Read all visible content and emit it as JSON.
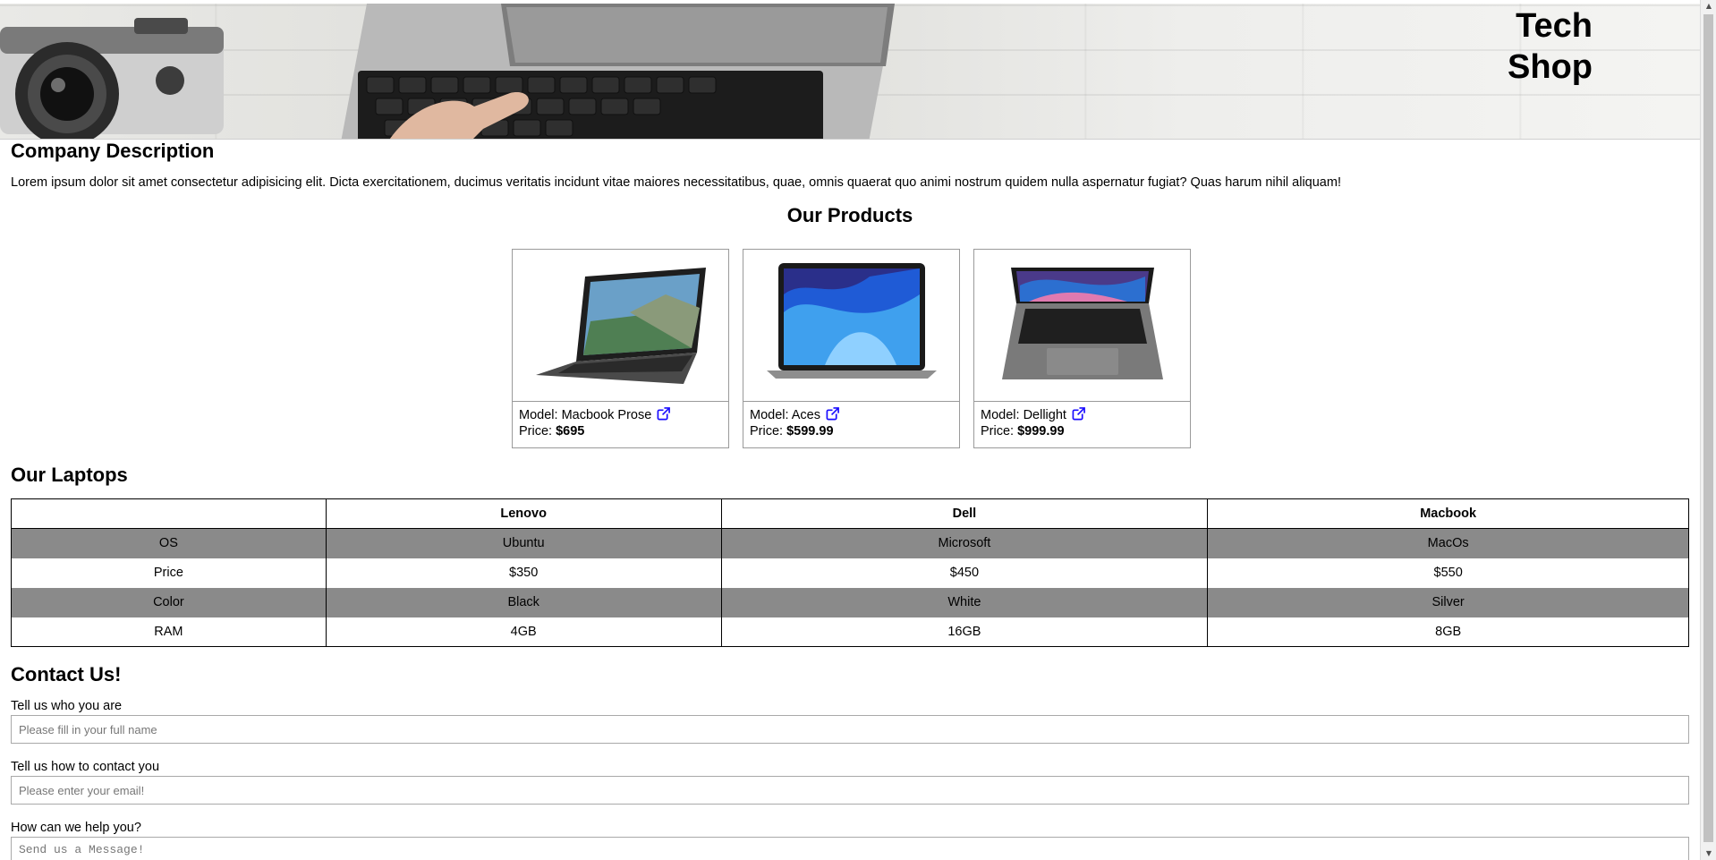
{
  "header": {
    "brand_line1": "Tech",
    "brand_line2": "Shop"
  },
  "company": {
    "title": "Company Description",
    "text": "Lorem ipsum dolor sit amet consectetur adipisicing elit. Dicta exercitationem, ducimus veritatis incidunt vitae maiores necessitatibus, quae, omnis quaerat quo animi nostrum quidem nulla aspernatur fugiat? Quas harum nihil aliquam!"
  },
  "products": {
    "title": "Our Products",
    "model_prefix": "Model: ",
    "price_prefix": "Price: ",
    "items": [
      {
        "model": "Macbook Prose",
        "price": "$695"
      },
      {
        "model": "Aces",
        "price": "$599.99"
      },
      {
        "model": "Dellight",
        "price": "$999.99"
      }
    ]
  },
  "laptops": {
    "title": "Our Laptops",
    "columns": [
      "",
      "Lenovo",
      "Dell",
      "Macbook"
    ],
    "rows": [
      [
        "OS",
        "Ubuntu",
        "Microsoft",
        "MacOs"
      ],
      [
        "Price",
        "$350",
        "$450",
        "$550"
      ],
      [
        "Color",
        "Black",
        "White",
        "Silver"
      ],
      [
        "RAM",
        "4GB",
        "16GB",
        "8GB"
      ]
    ]
  },
  "contact": {
    "title": "Contact Us!",
    "name_label": "Tell us who you are",
    "name_placeholder": "Please fill in your full name",
    "email_label": "Tell us how to contact you",
    "email_placeholder": "Please enter your email!",
    "message_label": "How can we help you?",
    "message_placeholder": "Send us a Message!"
  },
  "colors": {
    "link_icon": "#1a0dff",
    "row_alt": "#8a8a8a"
  },
  "icons": {
    "external_link": "external-link-icon"
  }
}
